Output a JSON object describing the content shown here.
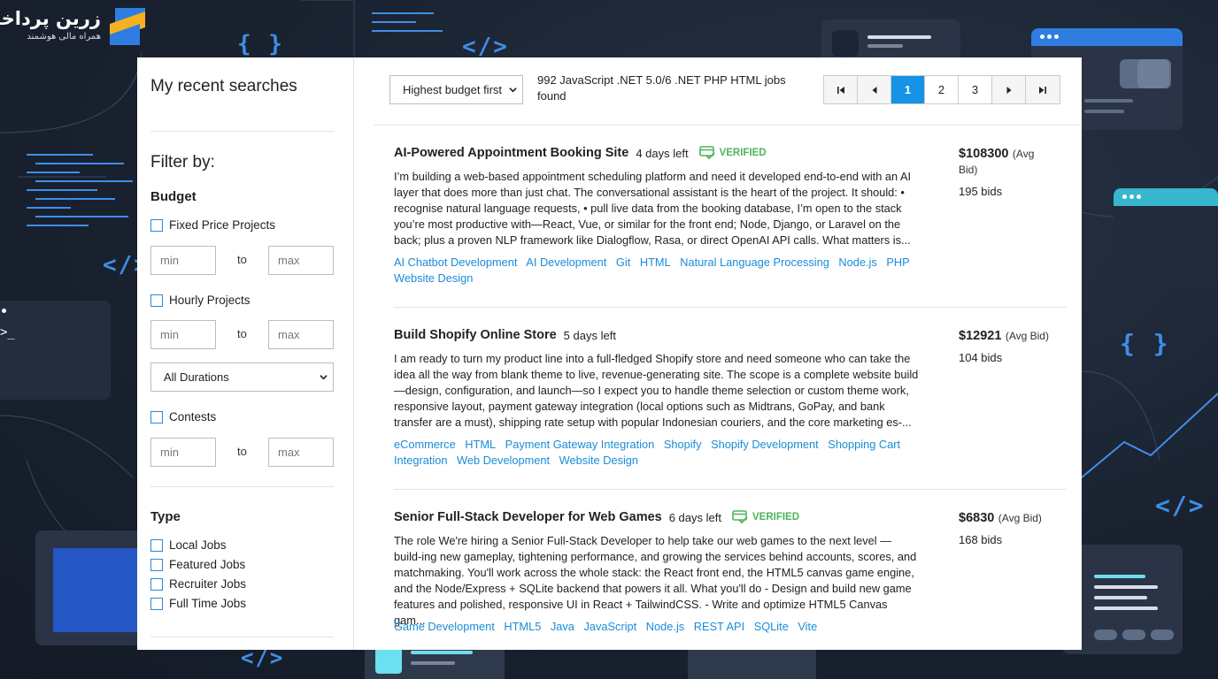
{
  "brand": {
    "title": "زرین پرداخت",
    "subtitle": "همراه مالی هوشمند"
  },
  "colors": {
    "accent": "#1593e6",
    "link": "#1a8cd8",
    "verified": "#4db55a",
    "background": "#1b2434"
  },
  "sidebar": {
    "recent_searches": "My recent searches",
    "filter_by": "Filter by:",
    "budget": {
      "title": "Budget",
      "fixed_price": "Fixed Price Projects",
      "hourly": "Hourly Projects",
      "contests": "Contests",
      "min_placeholder": "min",
      "max_placeholder": "max",
      "to": "to",
      "duration_select": "All Durations"
    },
    "type": {
      "title": "Type",
      "options": [
        "Local Jobs",
        "Featured Jobs",
        "Recruiter Jobs",
        "Full Time Jobs"
      ]
    }
  },
  "toolbar": {
    "sort": "Highest budget first",
    "results": "992 JavaScript .NET 5.0/6 .NET PHP HTML jobs found",
    "pages": [
      "1",
      "2",
      "3"
    ],
    "current_page": "1"
  },
  "jobs": [
    {
      "title": "AI-Powered Appointment Booking Site",
      "days_left": "4 days left",
      "verified": "VERIFIED",
      "description": "I’m building a web-based appointment scheduling platform and need it developed end-to-end with an AI layer that does more than just chat. The conversational assistant is the heart of the project. It should: • recognise natural language requests, • pull live data from the booking database, I’m open to the stack you’re most productive with—React, Vue, or similar for the front end; Node, Django, or Laravel on the back; plus a proven NLP framework like Dialogflow, Rasa, or direct OpenAI API calls. What matters is...",
      "tags": [
        "AI Chatbot Development",
        "AI Development",
        "Git",
        "HTML",
        "Natural Language Processing",
        "Node.js",
        "PHP",
        "Website Design"
      ],
      "price": "$108300",
      "avg_bid": "(Avg Bid)",
      "bids": "195 bids"
    },
    {
      "title": "Build Shopify Online Store",
      "days_left": "5 days left",
      "verified": "",
      "description": "I am ready to turn my product line into a full-fledged Shopify store and need someone who can take the idea all the way from blank theme to live, revenue-generating site. The scope is a complete website build—design, configuration, and launch—so I expect you to handle theme selection or custom theme work, responsive layout, payment gateway integration (local options such as Midtrans, GoPay, and bank transfer are a must), shipping rate setup with popular Indonesian couriers, and the core marketing es-...",
      "tags": [
        "eCommerce",
        "HTML",
        "Payment Gateway Integration",
        "Shopify",
        "Shopify Development",
        "Shopping Cart Integration",
        "Web Development",
        "Website Design"
      ],
      "price": "$12921",
      "avg_bid": "(Avg Bid)",
      "bids": "104 bids"
    },
    {
      "title": "Senior Full-Stack Developer for Web Games",
      "days_left": "6 days left",
      "verified": "VERIFIED",
      "description": "The role We're hiring a Senior Full-Stack Developer to help take our web games to the next level — build-ing new gameplay, tightening performance, and growing the services behind accounts, scores, and matchmaking. You'll work across the whole stack: the React front end, the HTML5 canvas game engine, and the Node/Express + SQLite backend that powers it all. What you'll do - Design and build new game features and polished, responsive UI in React + TailwindCSS. - Write and optimize HTML5 Canvas gam...",
      "tags": [
        "Game Development",
        "HTML5",
        "Java",
        "JavaScript",
        "Node.js",
        "REST API",
        "SQLite",
        "Vite"
      ],
      "price": "$6830",
      "avg_bid": "(Avg Bid)",
      "bids": "168 bids"
    }
  ]
}
